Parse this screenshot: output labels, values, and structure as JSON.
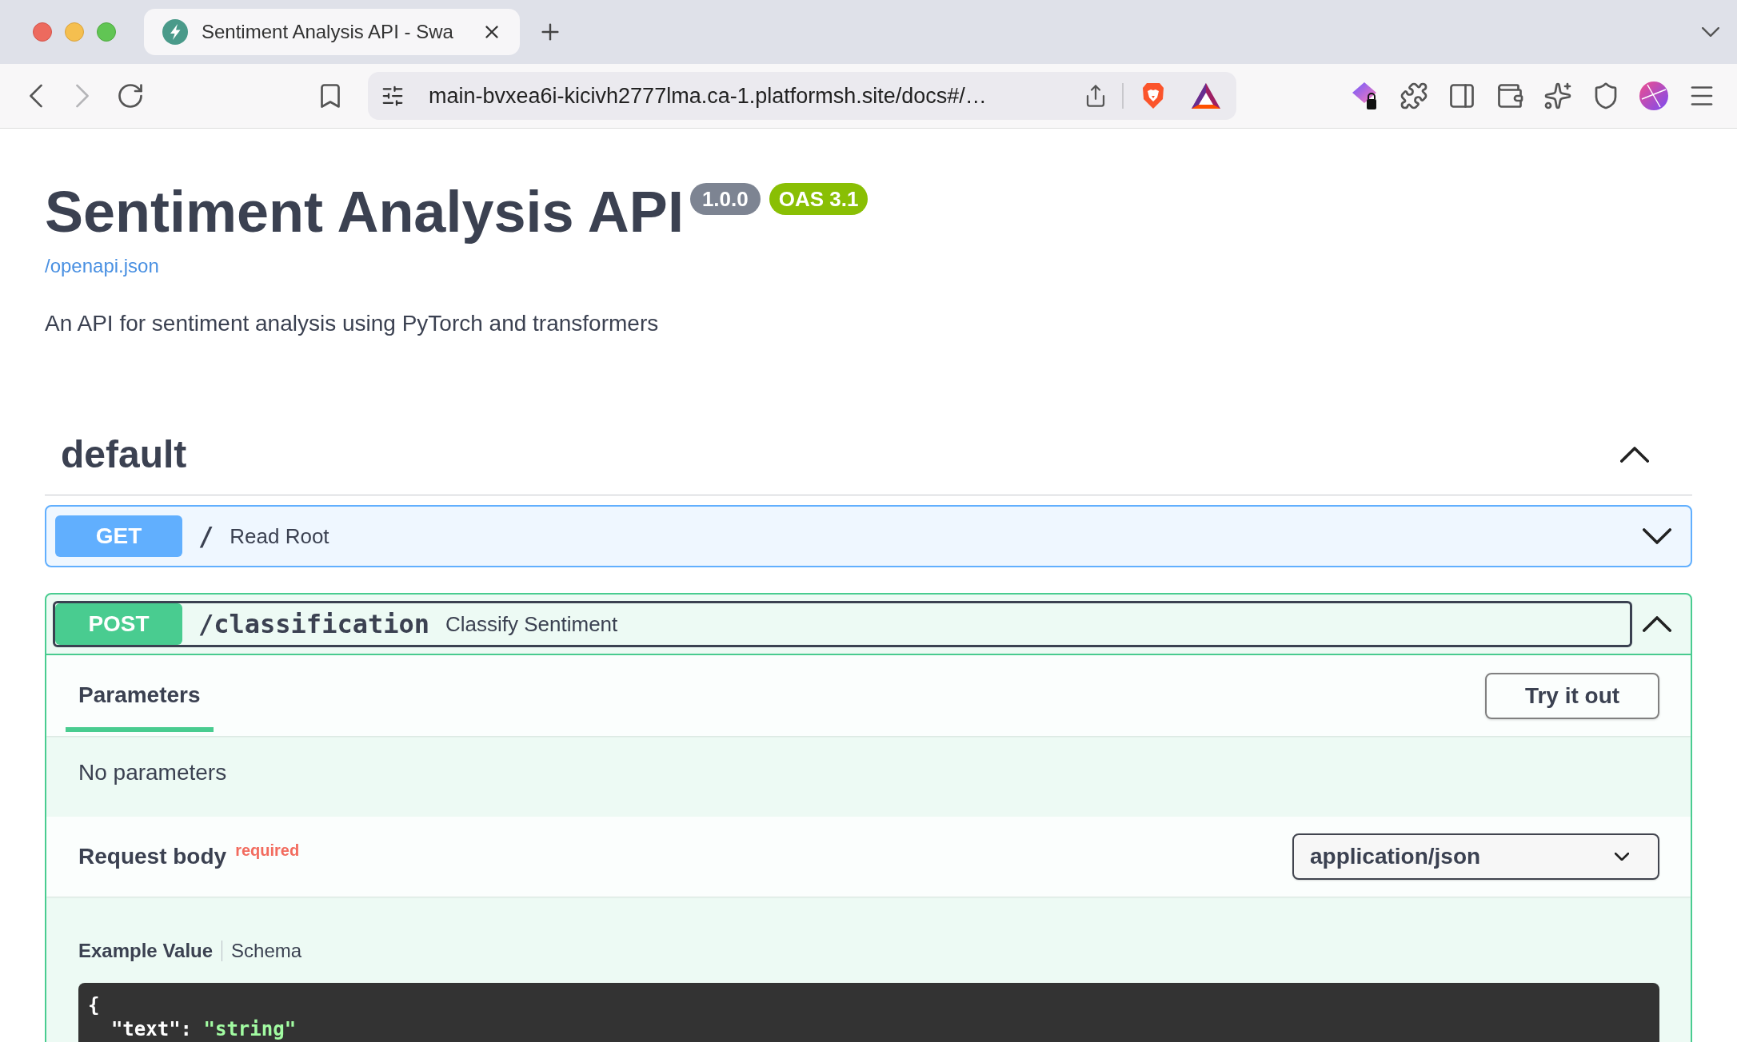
{
  "browser": {
    "tabs": [
      {
        "title": "Sentiment Analysis API - Swa",
        "selected": true
      }
    ],
    "forward_disabled": true,
    "address": "main-bvxea6i-kicivh2777lma.ca-1.platformsh.site/docs#/…"
  },
  "api": {
    "title": "Sentiment Analysis API",
    "version": "1.0.0",
    "spec_version": "OAS 3.1",
    "spec_link": "/openapi.json",
    "description": "An API for sentiment analysis using PyTorch and transformers"
  },
  "sections": [
    {
      "name": "default",
      "expanded": true,
      "operations": [
        {
          "method": "GET",
          "color": "#61affe",
          "path": "/",
          "summary": "Read Root",
          "expanded": false,
          "focused": false
        },
        {
          "method": "POST",
          "color": "#49cc90",
          "path": "/classification",
          "summary": "Classify Sentiment",
          "expanded": true,
          "focused": true,
          "tabs": [
            {
              "label": "Parameters",
              "selected": true
            }
          ],
          "try_it_out": "Try it out",
          "parameters_note": "No parameters",
          "request_body": {
            "label": "Request body",
            "required_mark": "required",
            "content_type": "application/json",
            "example_tabs": [
              {
                "label": "Example Value",
                "selected": true
              },
              {
                "label": "Schema",
                "selected": false
              }
            ],
            "example_lines": [
              [
                {
                  "kind": "plain",
                  "text": "{"
                }
              ],
              [
                {
                  "kind": "plain",
                  "text": "  \"text\": "
                },
                {
                  "kind": "string",
                  "text": "\"string\""
                }
              ]
            ]
          }
        }
      ]
    }
  ]
}
